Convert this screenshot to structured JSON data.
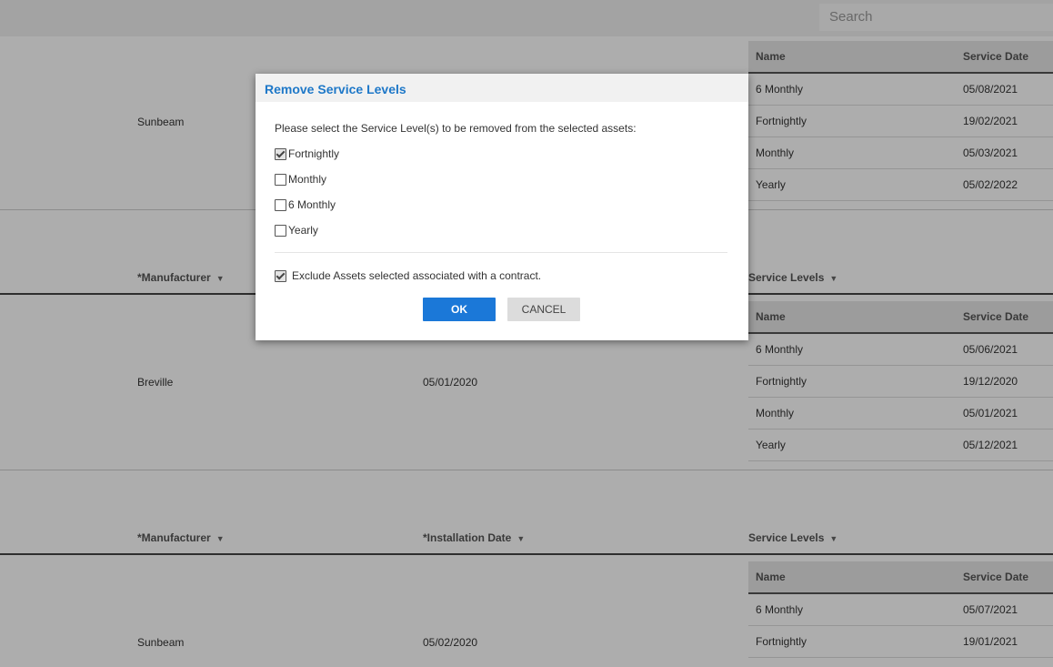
{
  "search": {
    "placeholder": "Search"
  },
  "columns": {
    "manufacturer": "*Manufacturer",
    "installation_date": "*Installation Date",
    "service_levels": "Service Levels",
    "sort_arrow": "▼"
  },
  "sl_columns": {
    "name": "Name",
    "service_date": "Service Date"
  },
  "records": [
    {
      "manufacturer": "Sunbeam",
      "installation_date": "",
      "service_levels": [
        {
          "name": "6 Monthly",
          "date": "05/08/2021"
        },
        {
          "name": "Fortnightly",
          "date": "19/02/2021"
        },
        {
          "name": "Monthly",
          "date": "05/03/2021"
        },
        {
          "name": "Yearly",
          "date": "05/02/2022"
        }
      ]
    },
    {
      "manufacturer": "Breville",
      "installation_date": "05/01/2020",
      "service_levels": [
        {
          "name": "6 Monthly",
          "date": "05/06/2021"
        },
        {
          "name": "Fortnightly",
          "date": "19/12/2020"
        },
        {
          "name": "Monthly",
          "date": "05/01/2021"
        },
        {
          "name": "Yearly",
          "date": "05/12/2021"
        }
      ]
    },
    {
      "manufacturer": "Sunbeam",
      "installation_date": "05/02/2020",
      "service_levels": [
        {
          "name": "6 Monthly",
          "date": "05/07/2021"
        },
        {
          "name": "Fortnightly",
          "date": "19/01/2021"
        }
      ]
    }
  ],
  "dialog": {
    "title": "Remove Service Levels",
    "prompt": "Please select the Service Level(s) to be removed from the selected assets:",
    "options": [
      {
        "label": "Fortnightly",
        "checked": true
      },
      {
        "label": "Monthly",
        "checked": false
      },
      {
        "label": "6 Monthly",
        "checked": false
      },
      {
        "label": "Yearly",
        "checked": false
      }
    ],
    "exclude": {
      "label": "Exclude Assets selected associated with a contract.",
      "checked": true
    },
    "ok_label": "OK",
    "cancel_label": "CANCEL"
  }
}
